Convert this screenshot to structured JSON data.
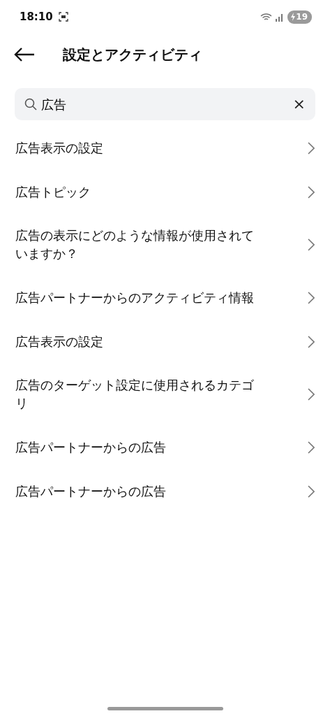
{
  "status_bar": {
    "time": "18:10",
    "battery": "19"
  },
  "header": {
    "title": "設定とアクティビティ"
  },
  "search": {
    "value": "広告",
    "clear": "×"
  },
  "results": [
    {
      "label": "広告表示の設定"
    },
    {
      "label": "広告トピック"
    },
    {
      "label": "広告の表示にどのような情報が使用されていますか？"
    },
    {
      "label": "広告パートナーからのアクティビティ情報"
    },
    {
      "label": "広告表示の設定"
    },
    {
      "label": "広告のターゲット設定に使用されるカテゴリ"
    },
    {
      "label": "広告パートナーからの広告"
    },
    {
      "label": "広告パートナーからの広告"
    }
  ]
}
